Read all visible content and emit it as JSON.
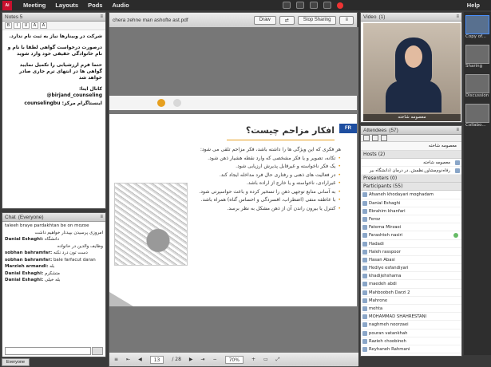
{
  "topbar": {
    "logo": "Ai",
    "menu": [
      "Meeting",
      "Layouts",
      "Pods",
      "Audio"
    ],
    "help": "Help"
  },
  "notes": {
    "title": "Notes 5",
    "toolbar": [
      "B",
      "I",
      "U",
      "A",
      "A"
    ],
    "lines": [
      "شرکت در وبینارها نیاز به ثبت نام ندارد.",
      "درصورت درخواست گواهی لطفا با نام و نام خانوادگی حقیقی خود وارد شوید",
      "حتما فرم ارزشیابی را تکمیل نمایید گواهی ها در انتهای ترم جاری صادر خواهد شد"
    ],
    "eitaa_label": "کانال ایتا:",
    "eitaa_handle": "@birjand_counseling",
    "insta_label": "اینستاگرام مرکز:",
    "insta_handle": "counselingbu"
  },
  "chat": {
    "title": "Chat",
    "audience": "(Everyone)",
    "messages": [
      {
        "sender": "",
        "text": "taleeh  braye pardakhtan be on mozoe"
      },
      {
        "sender": "",
        "text": "امروزی پرسیدن بپیدنار خواهیم داشت"
      },
      {
        "sender": "Danial Eshaghi:",
        "text": "دانشگاه"
      },
      {
        "sender": "",
        "text": "وظایف والدین در خانواده"
      },
      {
        "sender": "sobhan bahramfar:",
        "text": "دست تون درد نکنه"
      },
      {
        "sender": "sobhan bahramfar:",
        "text": "bale farfacut daran"
      },
      {
        "sender": "Marzieh armandi:",
        "text": "بله"
      },
      {
        "sender": "Danial Eshaghi:",
        "text": "متشکرم"
      },
      {
        "sender": "Danial Eshaghi:",
        "text": "بله خیلی"
      }
    ],
    "tab": "Everyone"
  },
  "share": {
    "file": "chera zehne man ashofte ast.pdf",
    "draw": "Draw",
    "stop": "Stop Sharing",
    "slide_title": "افکار مزاحم چیست؟",
    "slide_brand": "FR",
    "slide_intro": "هر فکری که این ویژگی ها را داشته باشد، فکر مزاحم تلقی می شود:",
    "bullets": [
      "تکانه، تصویر و یا فکر مشخصی که وارد نقطه هشیار ذهن شود.",
      "یک فکر ناخواسته و غیرقابل پذیرش ارزیابی شود.",
      "در فعالیت های ذهنی و رفتاری حال فرد مداخله ایجاد کند.",
      "غیرارادی، ناخواسته و یا خارج از اراده باشد.",
      "به آسانی منابع توجهی ذهن را تسخیر کرده و باعث حواسپرتی شود.",
      "با عاطفه منفی (اضطراب، افسردگی و احساس گناه) همراه باشد.",
      "کنترل یا بیرون راندن آن از ذهن مشکل به نظر برسد."
    ],
    "page_current": "13",
    "page_total": "/ 28",
    "zoom": "70%"
  },
  "video": {
    "title": "Video",
    "count": "(1)",
    "presenter": "معصومه شاخته"
  },
  "attendees": {
    "title": "Attendees",
    "count": "(57)",
    "me": "معصومه شاخته",
    "hosts_label": "Hosts (2)",
    "hosts": [
      "معصومه شاخته",
      "رفاه‌دوم‌مشاور,نظمش, در درمان (دانشگاه بیر"
    ],
    "presenters_label": "Presenters (0)",
    "participants_label": "Participants (55)",
    "participants": [
      "Afsaneh khodayari moghadam",
      "Danial Eshaghi",
      "Ebrahim khanfari",
      "Feroz",
      "Fatema Mirzaei",
      "Farashteh nasiri",
      "Hadadi",
      "Haleh rasspoor",
      "Hasan Abasi",
      "Hediye esfandiyari",
      "khadijehshama",
      "maedeh abdi",
      "Mahboobeh Darzi 2",
      "Mahrone",
      "mehta",
      "MOHAMMAD SHAHRESTANI",
      "naghmeh noorzaei",
      "pouran vatankhah",
      "Razieh choobineh",
      "Reyhaneh Rahmani"
    ]
  },
  "thumbs": [
    "Copy of...",
    "Sharing",
    "Discussion",
    "Collabo..."
  ]
}
